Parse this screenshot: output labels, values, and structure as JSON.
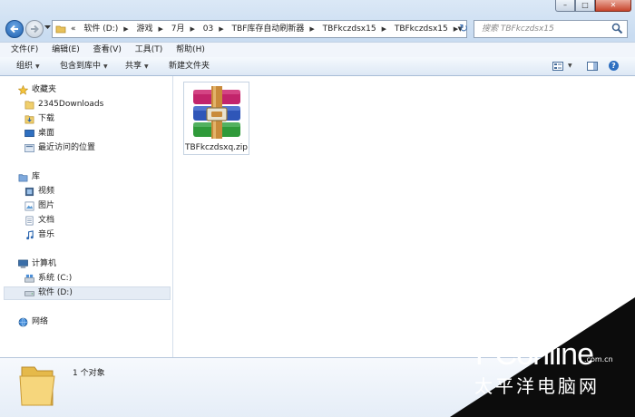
{
  "address": {
    "history_marker": "«",
    "crumbs": [
      "软件 (D:)",
      "游戏",
      "7月",
      "03",
      "TBF库存自动刷新器",
      "TBFkczdsx15",
      "TBFkczdsx15"
    ],
    "search_placeholder": "搜索 TBFkczdsx15"
  },
  "menu": [
    "文件(F)",
    "编辑(E)",
    "查看(V)",
    "工具(T)",
    "帮助(H)"
  ],
  "commands": {
    "organize": "组织",
    "include_in_library": "包含到库中",
    "share": "共享",
    "new_folder": "新建文件夹"
  },
  "nav": {
    "favorites": "收藏夹",
    "fav_items": [
      "2345Downloads",
      "下载",
      "桌面",
      "最近访问的位置"
    ],
    "libraries": "库",
    "lib_items": [
      "视频",
      "图片",
      "文档",
      "音乐"
    ],
    "computer": "计算机",
    "drives": [
      "系统 (C:)",
      "软件 (D:)"
    ],
    "network": "网络"
  },
  "files": [
    {
      "name": "TBFkczdsxq.zip",
      "icon": "winrar-archive-icon"
    }
  ],
  "status": {
    "count": "1 个对象"
  },
  "watermark": {
    "brand": "PConline",
    "domain": ".com.cn",
    "cn": "太平洋电脑网"
  },
  "colors": {
    "accent": "#2e6fc0",
    "selection": "#e5ecf5"
  }
}
